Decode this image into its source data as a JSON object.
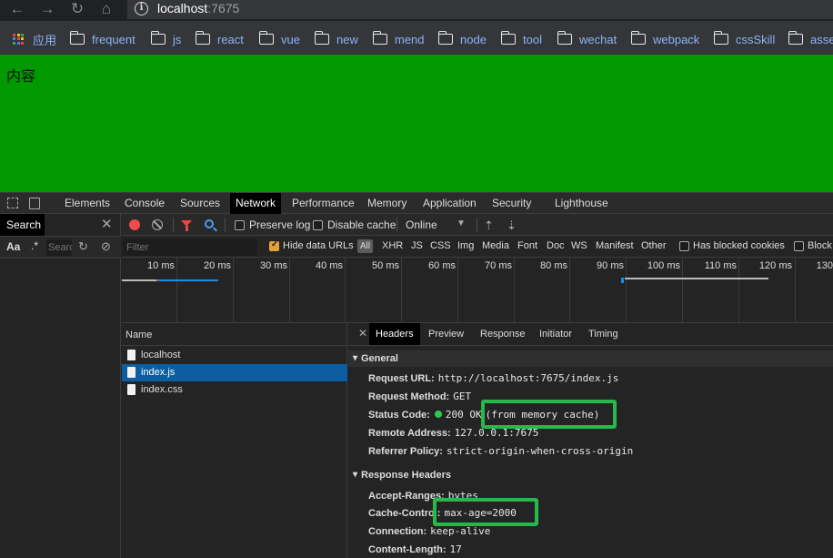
{
  "browser": {
    "url_host": "localhost",
    "url_port": ":7675",
    "bookmarks": [
      "应用",
      "frequent",
      "js",
      "react",
      "vue",
      "new",
      "mend",
      "node",
      "tool",
      "wechat",
      "webpack",
      "cssSkill",
      "asse"
    ]
  },
  "page": {
    "content_text": "内容",
    "background": "#009900"
  },
  "devtools": {
    "tabs": [
      "Elements",
      "Console",
      "Sources",
      "Network",
      "Performance",
      "Memory",
      "Application",
      "Security",
      "Lighthouse"
    ],
    "active_tab": "Network",
    "left": {
      "search_tab": "Search",
      "aa": "Aa",
      "regex": ".*",
      "search_placeholder": "Search"
    },
    "toolbar": {
      "preserve_log": "Preserve log",
      "disable_cache": "Disable cache",
      "throttle": "Online"
    },
    "filter": {
      "placeholder": "Filter",
      "hide_data_urls": "Hide data URLs",
      "types": [
        "All",
        "XHR",
        "JS",
        "CSS",
        "Img",
        "Media",
        "Font",
        "Doc",
        "WS",
        "Manifest",
        "Other"
      ],
      "has_blocked_cookies": "Has blocked cookies",
      "blocked": "Block"
    },
    "timeline_ticks": [
      "10 ms",
      "20 ms",
      "30 ms",
      "40 ms",
      "50 ms",
      "60 ms",
      "70 ms",
      "80 ms",
      "90 ms",
      "100 ms",
      "110 ms",
      "120 ms",
      "130"
    ],
    "name_header": "Name",
    "files": [
      "localhost",
      "index.js",
      "index.css"
    ],
    "selected_file": "index.js",
    "detail_tabs": [
      "Headers",
      "Preview",
      "Response",
      "Initiator",
      "Timing"
    ],
    "general": {
      "title": "General",
      "request_url_k": "Request URL:",
      "request_url_v": "http://localhost:7675/index.js",
      "method_k": "Request Method:",
      "method_v": "GET",
      "status_k": "Status Code:",
      "status_v": "200 OK",
      "status_note": "(from memory cache)",
      "remote_k": "Remote Address:",
      "remote_v": "127.0.0.1:7675",
      "referrer_k": "Referrer Policy:",
      "referrer_v": "strict-origin-when-cross-origin"
    },
    "response_headers": {
      "title": "Response Headers",
      "accept_ranges_k": "Accept-Ranges:",
      "accept_ranges_v": "bytes",
      "cache_control_k": "Cache-Control:",
      "cache_control_v": "max-age=2000",
      "connection_k": "Connection:",
      "connection_v": "keep-alive",
      "content_length_k": "Content-Length:",
      "content_length_v": "17"
    }
  }
}
